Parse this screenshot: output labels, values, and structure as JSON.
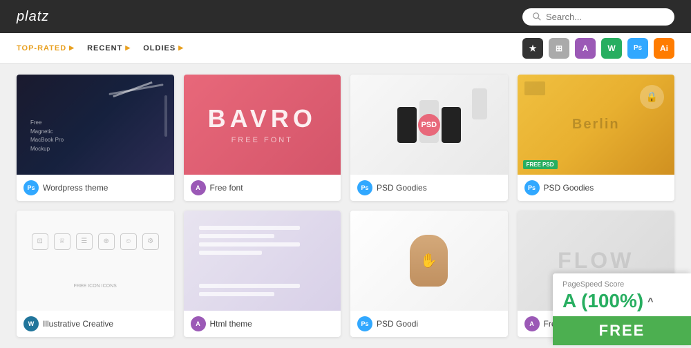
{
  "header": {
    "logo": "platz",
    "search_placeholder": "Search..."
  },
  "nav": {
    "tabs": [
      {
        "id": "top-rated",
        "label": "TOP-RATED",
        "active": true,
        "arrow": "▶"
      },
      {
        "id": "recent",
        "label": "RECENT",
        "active": false,
        "arrow": "▶"
      },
      {
        "id": "oldies",
        "label": "OLDIES",
        "active": false,
        "arrow": "▶"
      }
    ],
    "filters": [
      {
        "id": "star",
        "symbol": "★",
        "style": "dark"
      },
      {
        "id": "image",
        "symbol": "⊞",
        "style": "gray"
      },
      {
        "id": "a-purple",
        "symbol": "A",
        "style": "purple"
      },
      {
        "id": "wp",
        "symbol": "W",
        "style": "green"
      },
      {
        "id": "ps",
        "symbol": "Ps",
        "style": "blue-ps"
      },
      {
        "id": "ai",
        "symbol": "Ai",
        "style": "orange"
      }
    ]
  },
  "cards": [
    {
      "id": "card-1",
      "title": "Wordpress theme",
      "badge_type": "ps",
      "badge_label": "Ps",
      "image_type": "dark"
    },
    {
      "id": "card-2",
      "title": "Free font",
      "badge_type": "a",
      "badge_label": "A",
      "image_type": "pink"
    },
    {
      "id": "card-3",
      "title": "PSD Goodies",
      "badge_type": "ps",
      "badge_label": "Ps",
      "image_type": "phones"
    },
    {
      "id": "card-4",
      "title": "PSD Goodies",
      "badge_type": "ps",
      "badge_label": "Ps",
      "image_type": "berlin"
    },
    {
      "id": "card-5",
      "title": "Illustrative Creative",
      "badge_type": "wp",
      "badge_label": "Wp",
      "image_type": "icons"
    },
    {
      "id": "card-6",
      "title": "Html theme",
      "badge_type": "a",
      "badge_label": "A",
      "image_type": "html"
    },
    {
      "id": "card-7",
      "title": "PSD Goodi",
      "badge_type": "ps",
      "badge_label": "Ps",
      "image_type": "psd-goods"
    },
    {
      "id": "card-8",
      "title": "Free font",
      "badge_type": "a",
      "badge_label": "A",
      "image_type": "free"
    }
  ],
  "pagespeed": {
    "label": "PageSpeed Score",
    "score": "A (100%)",
    "arrow": "^",
    "cta": "FREE"
  }
}
